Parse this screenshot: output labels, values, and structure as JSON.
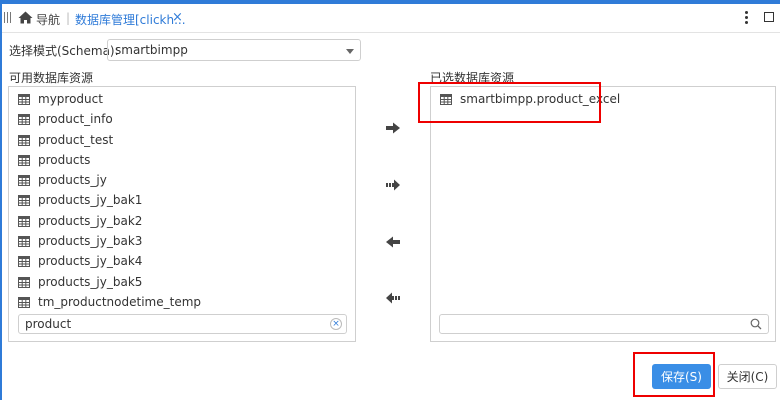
{
  "tabbar": {
    "nav_label": "导航",
    "separator": "|",
    "tab_title": "数据库管理[clickh...",
    "tab_close": "×"
  },
  "schema": {
    "label": "选择模式(Schema):",
    "selected": "smartbimpp"
  },
  "available": {
    "heading": "可用数据库资源",
    "items": [
      "myproduct",
      "product_info",
      "product_test",
      "products",
      "products_jy",
      "products_jy_bak1",
      "products_jy_bak2",
      "products_jy_bak3",
      "products_jy_bak4",
      "products_jy_bak5",
      "tm_productnodetime_temp"
    ],
    "filter_value": "product",
    "clear_glyph": "×"
  },
  "selected_resources": {
    "heading": "已选数据库资源",
    "items": [
      "smartbimpp.product_excel"
    ],
    "filter_value": ""
  },
  "buttons": {
    "save": "保存(S)",
    "close": "关闭(C)"
  },
  "colors": {
    "accent": "#2f7bd8",
    "primary_button": "#3a8ee6",
    "highlight": "#e00000"
  }
}
